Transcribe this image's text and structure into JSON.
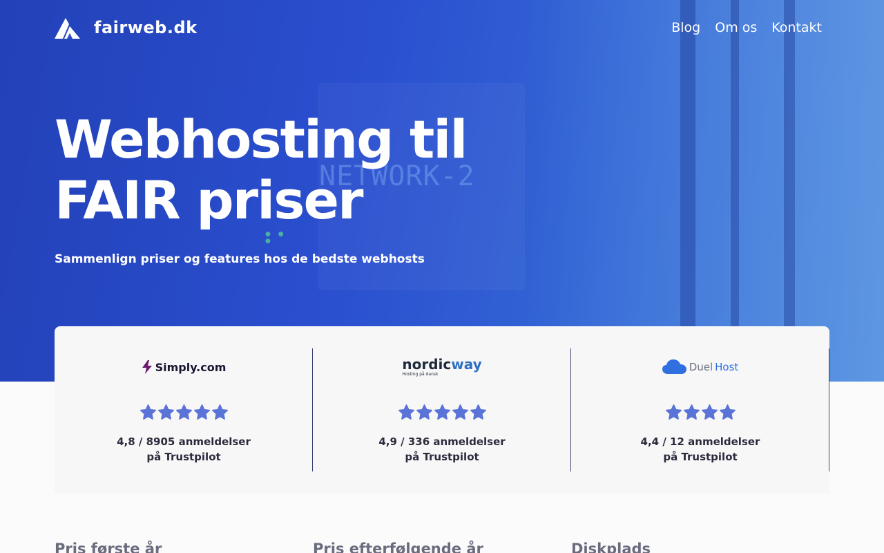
{
  "brand": {
    "name": "fairweb.dk"
  },
  "nav": {
    "links": [
      "Blog",
      "Om os",
      "Kontakt"
    ]
  },
  "hero": {
    "headline_line1": "Webhosting til",
    "headline_line2": "FAIR priser",
    "subheadline": "Sammenlign priser og features hos de bedste webhosts",
    "background_text": "NETWORK-2"
  },
  "hosts": [
    {
      "logo_text": "Simply.com",
      "rating": 4.8,
      "stars": 5,
      "rating_line1": "4,8 / 8905 anmeldelser",
      "rating_line2": "på Trustpilot"
    },
    {
      "logo_text_main": "nordic",
      "logo_text_accent": "way",
      "logo_tagline": "Hosting på dansk",
      "rating": 4.9,
      "stars": 5,
      "rating_line1": "4,9 / 336 anmeldelser",
      "rating_line2": "på Trustpilot"
    },
    {
      "logo_text_main": "Duel",
      "logo_text_accent": "Host",
      "rating": 4.4,
      "stars": 4,
      "rating_line1": "4,4 / 12 anmeldelser",
      "rating_line2": "på Trustpilot"
    }
  ],
  "features": [
    "Pris første år",
    "Pris efterfølgende år",
    "Diskplads"
  ],
  "colors": {
    "hero_blue": "#2a4fcf",
    "star": "#5a73d6",
    "card_bg": "#f8f7f8",
    "divider": "#3b3f6b",
    "simply_purple": "#6a1b6e",
    "nordic_blue": "#2f6fbf",
    "duel_blue": "#2f6fe0"
  }
}
